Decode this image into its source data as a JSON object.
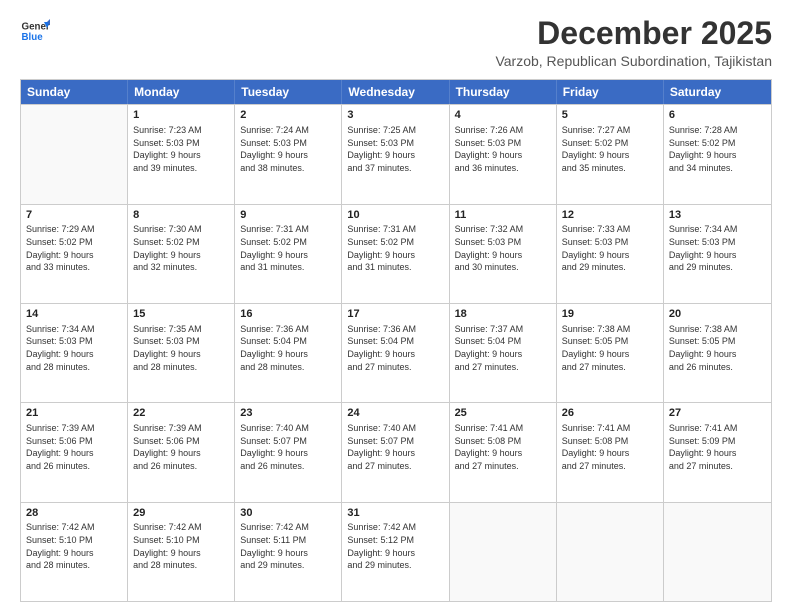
{
  "logo": {
    "line1": "General",
    "line2": "Blue"
  },
  "title": "December 2025",
  "subtitle": "Varzob, Republican Subordination, Tajikistan",
  "header_days": [
    "Sunday",
    "Monday",
    "Tuesday",
    "Wednesday",
    "Thursday",
    "Friday",
    "Saturday"
  ],
  "rows": [
    [
      {
        "day": "",
        "text": ""
      },
      {
        "day": "1",
        "text": "Sunrise: 7:23 AM\nSunset: 5:03 PM\nDaylight: 9 hours\nand 39 minutes."
      },
      {
        "day": "2",
        "text": "Sunrise: 7:24 AM\nSunset: 5:03 PM\nDaylight: 9 hours\nand 38 minutes."
      },
      {
        "day": "3",
        "text": "Sunrise: 7:25 AM\nSunset: 5:03 PM\nDaylight: 9 hours\nand 37 minutes."
      },
      {
        "day": "4",
        "text": "Sunrise: 7:26 AM\nSunset: 5:03 PM\nDaylight: 9 hours\nand 36 minutes."
      },
      {
        "day": "5",
        "text": "Sunrise: 7:27 AM\nSunset: 5:02 PM\nDaylight: 9 hours\nand 35 minutes."
      },
      {
        "day": "6",
        "text": "Sunrise: 7:28 AM\nSunset: 5:02 PM\nDaylight: 9 hours\nand 34 minutes."
      }
    ],
    [
      {
        "day": "7",
        "text": "Sunrise: 7:29 AM\nSunset: 5:02 PM\nDaylight: 9 hours\nand 33 minutes."
      },
      {
        "day": "8",
        "text": "Sunrise: 7:30 AM\nSunset: 5:02 PM\nDaylight: 9 hours\nand 32 minutes."
      },
      {
        "day": "9",
        "text": "Sunrise: 7:31 AM\nSunset: 5:02 PM\nDaylight: 9 hours\nand 31 minutes."
      },
      {
        "day": "10",
        "text": "Sunrise: 7:31 AM\nSunset: 5:02 PM\nDaylight: 9 hours\nand 31 minutes."
      },
      {
        "day": "11",
        "text": "Sunrise: 7:32 AM\nSunset: 5:03 PM\nDaylight: 9 hours\nand 30 minutes."
      },
      {
        "day": "12",
        "text": "Sunrise: 7:33 AM\nSunset: 5:03 PM\nDaylight: 9 hours\nand 29 minutes."
      },
      {
        "day": "13",
        "text": "Sunrise: 7:34 AM\nSunset: 5:03 PM\nDaylight: 9 hours\nand 29 minutes."
      }
    ],
    [
      {
        "day": "14",
        "text": "Sunrise: 7:34 AM\nSunset: 5:03 PM\nDaylight: 9 hours\nand 28 minutes."
      },
      {
        "day": "15",
        "text": "Sunrise: 7:35 AM\nSunset: 5:03 PM\nDaylight: 9 hours\nand 28 minutes."
      },
      {
        "day": "16",
        "text": "Sunrise: 7:36 AM\nSunset: 5:04 PM\nDaylight: 9 hours\nand 28 minutes."
      },
      {
        "day": "17",
        "text": "Sunrise: 7:36 AM\nSunset: 5:04 PM\nDaylight: 9 hours\nand 27 minutes."
      },
      {
        "day": "18",
        "text": "Sunrise: 7:37 AM\nSunset: 5:04 PM\nDaylight: 9 hours\nand 27 minutes."
      },
      {
        "day": "19",
        "text": "Sunrise: 7:38 AM\nSunset: 5:05 PM\nDaylight: 9 hours\nand 27 minutes."
      },
      {
        "day": "20",
        "text": "Sunrise: 7:38 AM\nSunset: 5:05 PM\nDaylight: 9 hours\nand 26 minutes."
      }
    ],
    [
      {
        "day": "21",
        "text": "Sunrise: 7:39 AM\nSunset: 5:06 PM\nDaylight: 9 hours\nand 26 minutes."
      },
      {
        "day": "22",
        "text": "Sunrise: 7:39 AM\nSunset: 5:06 PM\nDaylight: 9 hours\nand 26 minutes."
      },
      {
        "day": "23",
        "text": "Sunrise: 7:40 AM\nSunset: 5:07 PM\nDaylight: 9 hours\nand 26 minutes."
      },
      {
        "day": "24",
        "text": "Sunrise: 7:40 AM\nSunset: 5:07 PM\nDaylight: 9 hours\nand 27 minutes."
      },
      {
        "day": "25",
        "text": "Sunrise: 7:41 AM\nSunset: 5:08 PM\nDaylight: 9 hours\nand 27 minutes."
      },
      {
        "day": "26",
        "text": "Sunrise: 7:41 AM\nSunset: 5:08 PM\nDaylight: 9 hours\nand 27 minutes."
      },
      {
        "day": "27",
        "text": "Sunrise: 7:41 AM\nSunset: 5:09 PM\nDaylight: 9 hours\nand 27 minutes."
      }
    ],
    [
      {
        "day": "28",
        "text": "Sunrise: 7:42 AM\nSunset: 5:10 PM\nDaylight: 9 hours\nand 28 minutes."
      },
      {
        "day": "29",
        "text": "Sunrise: 7:42 AM\nSunset: 5:10 PM\nDaylight: 9 hours\nand 28 minutes."
      },
      {
        "day": "30",
        "text": "Sunrise: 7:42 AM\nSunset: 5:11 PM\nDaylight: 9 hours\nand 29 minutes."
      },
      {
        "day": "31",
        "text": "Sunrise: 7:42 AM\nSunset: 5:12 PM\nDaylight: 9 hours\nand 29 minutes."
      },
      {
        "day": "",
        "text": ""
      },
      {
        "day": "",
        "text": ""
      },
      {
        "day": "",
        "text": ""
      }
    ]
  ]
}
